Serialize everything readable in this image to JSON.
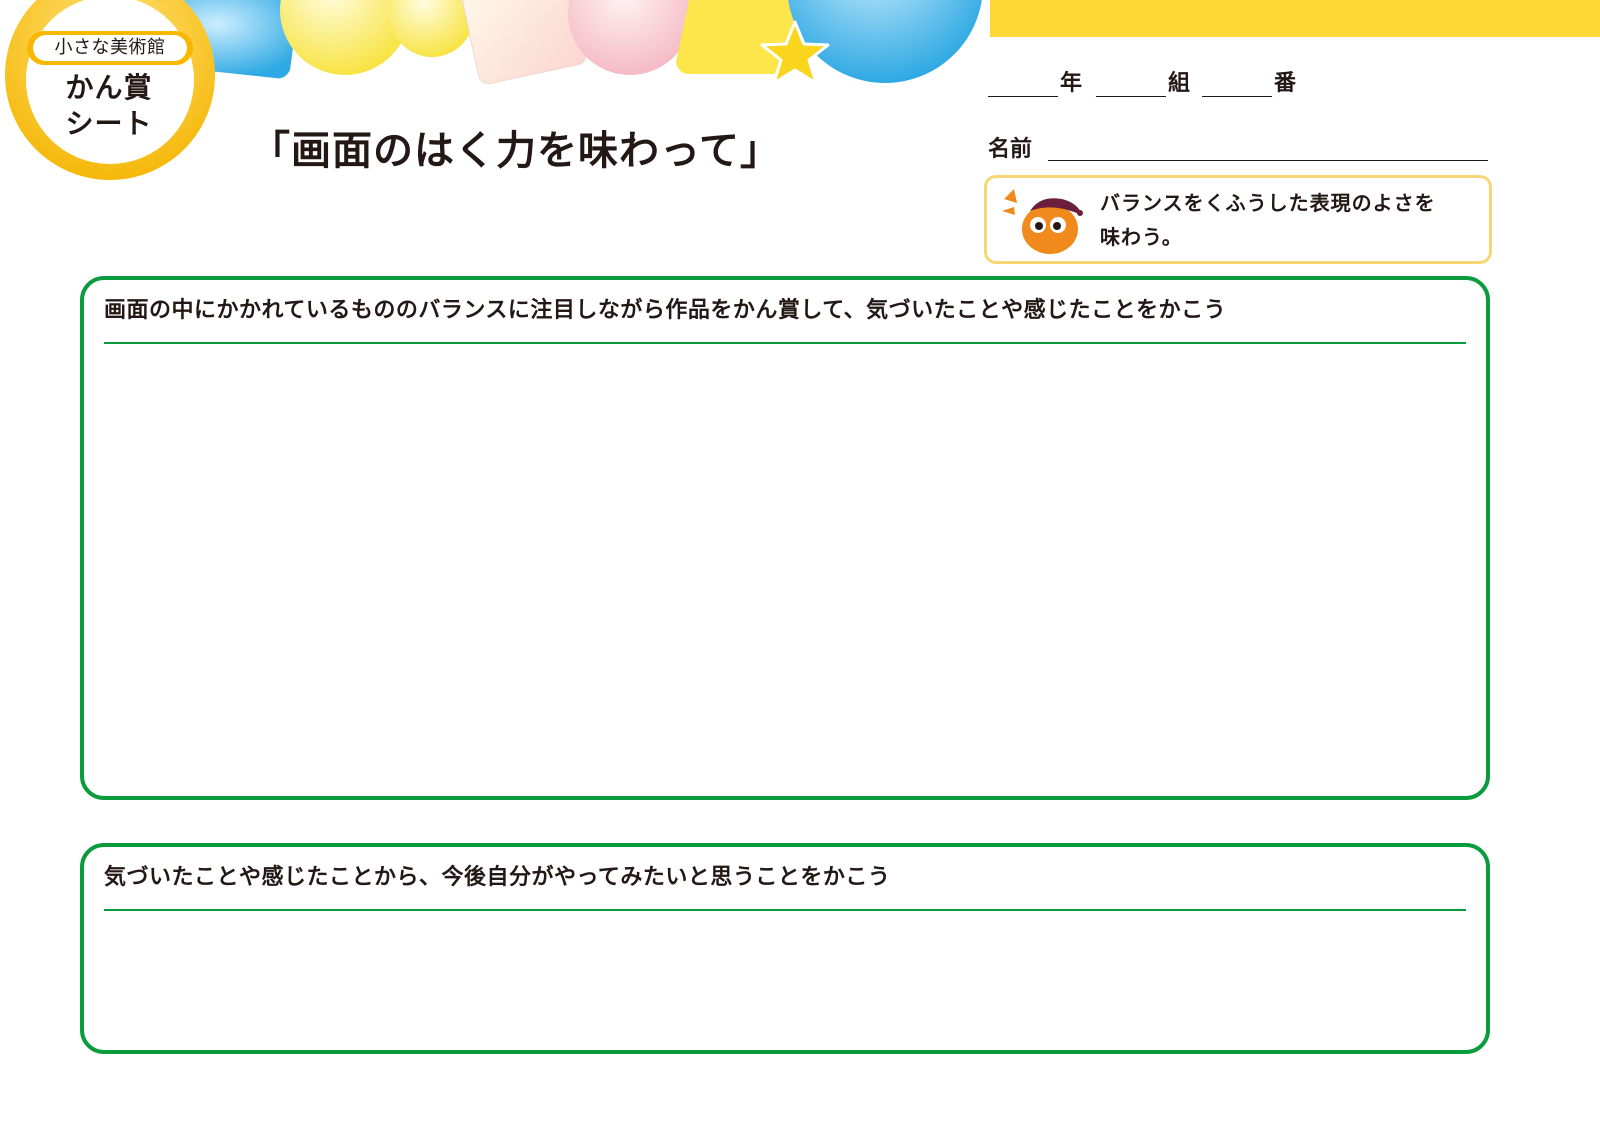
{
  "colors": {
    "accent_yellow": "#fdd835",
    "badge_orange": "#f9b800",
    "box_green": "#0a9b3d",
    "goal_border": "#f7d673",
    "text": "#231815"
  },
  "badge": {
    "series_label": "小さな美術館",
    "title_line1": "かん賞",
    "title_line2": "シート"
  },
  "title": "「画面のはく力を味わって」",
  "student_info": {
    "grade_label": "年",
    "class_label": "組",
    "number_label": "番",
    "name_label": "名前"
  },
  "goal": {
    "mascot_icon": "painter-mascot-icon",
    "line1": "バランスをくふうした表現のよさを",
    "line2": "味わう。"
  },
  "sections": [
    {
      "prompt": "画面の中にかかれているもののバランスに注目しながら作品をかん賞して、気づいたことや感じたことをかこう",
      "answer": ""
    },
    {
      "prompt": "気づいたことや感じたことから、今後自分がやってみたいと思うことをかこう",
      "answer": ""
    }
  ]
}
